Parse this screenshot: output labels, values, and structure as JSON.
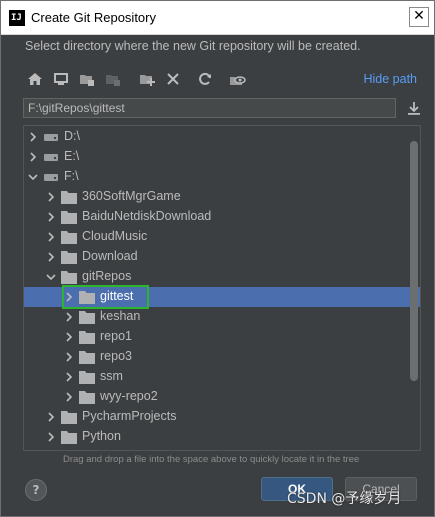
{
  "window": {
    "title": "Create Git Repository",
    "app_icon_label": "IJ",
    "close_glyph": "✕",
    "description": "Select directory where the new Git repository will be created."
  },
  "toolbar": {
    "icons": [
      "home-icon",
      "desktop-icon",
      "project-folder-icon",
      "module-folder-icon",
      "new-folder-icon",
      "delete-icon",
      "refresh-icon",
      "show-hidden-icon"
    ],
    "hide_path_label": "Hide path"
  },
  "path_field": {
    "value": "F:\\gitRepos\\gittest"
  },
  "tree": {
    "rows": [
      {
        "label": "D:\\",
        "expanded": false,
        "selected": false,
        "icon": "drive-icon"
      },
      {
        "label": "E:\\",
        "expanded": false,
        "selected": false,
        "icon": "drive-icon"
      },
      {
        "label": "F:\\",
        "expanded": true,
        "selected": false,
        "icon": "drive-icon"
      },
      {
        "label": "360SoftMgrGame",
        "expanded": false,
        "selected": false,
        "icon": "folder-icon"
      },
      {
        "label": "BaiduNetdiskDownload",
        "expanded": false,
        "selected": false,
        "icon": "folder-icon"
      },
      {
        "label": "CloudMusic",
        "expanded": false,
        "selected": false,
        "icon": "folder-icon"
      },
      {
        "label": "Download",
        "expanded": false,
        "selected": false,
        "icon": "folder-icon"
      },
      {
        "label": "gitRepos",
        "expanded": true,
        "selected": false,
        "icon": "folder-icon"
      },
      {
        "label": "gittest",
        "expanded": false,
        "selected": true,
        "icon": "folder-icon"
      },
      {
        "label": "keshan",
        "expanded": false,
        "selected": false,
        "icon": "folder-icon"
      },
      {
        "label": "repo1",
        "expanded": false,
        "selected": false,
        "icon": "folder-icon"
      },
      {
        "label": "repo3",
        "expanded": false,
        "selected": false,
        "icon": "folder-icon"
      },
      {
        "label": "ssm",
        "expanded": false,
        "selected": false,
        "icon": "folder-icon"
      },
      {
        "label": "wyy-repo2",
        "expanded": false,
        "selected": false,
        "icon": "folder-icon"
      },
      {
        "label": "PycharmProjects",
        "expanded": false,
        "selected": false,
        "icon": "folder-icon"
      },
      {
        "label": "Python",
        "expanded": false,
        "selected": false,
        "icon": "folder-icon"
      }
    ]
  },
  "hint": "Drag and drop a file into the space above to quickly locate it in the tree",
  "buttons": {
    "help": "?",
    "ok": "OK",
    "cancel": "Cancel"
  },
  "watermark": "CSDN @予缘岁月",
  "colors": {
    "accent": "#589df6",
    "selection": "#4b6eaf",
    "highlight_box": "#2db52d",
    "dialog_bg": "#3c3f41"
  }
}
